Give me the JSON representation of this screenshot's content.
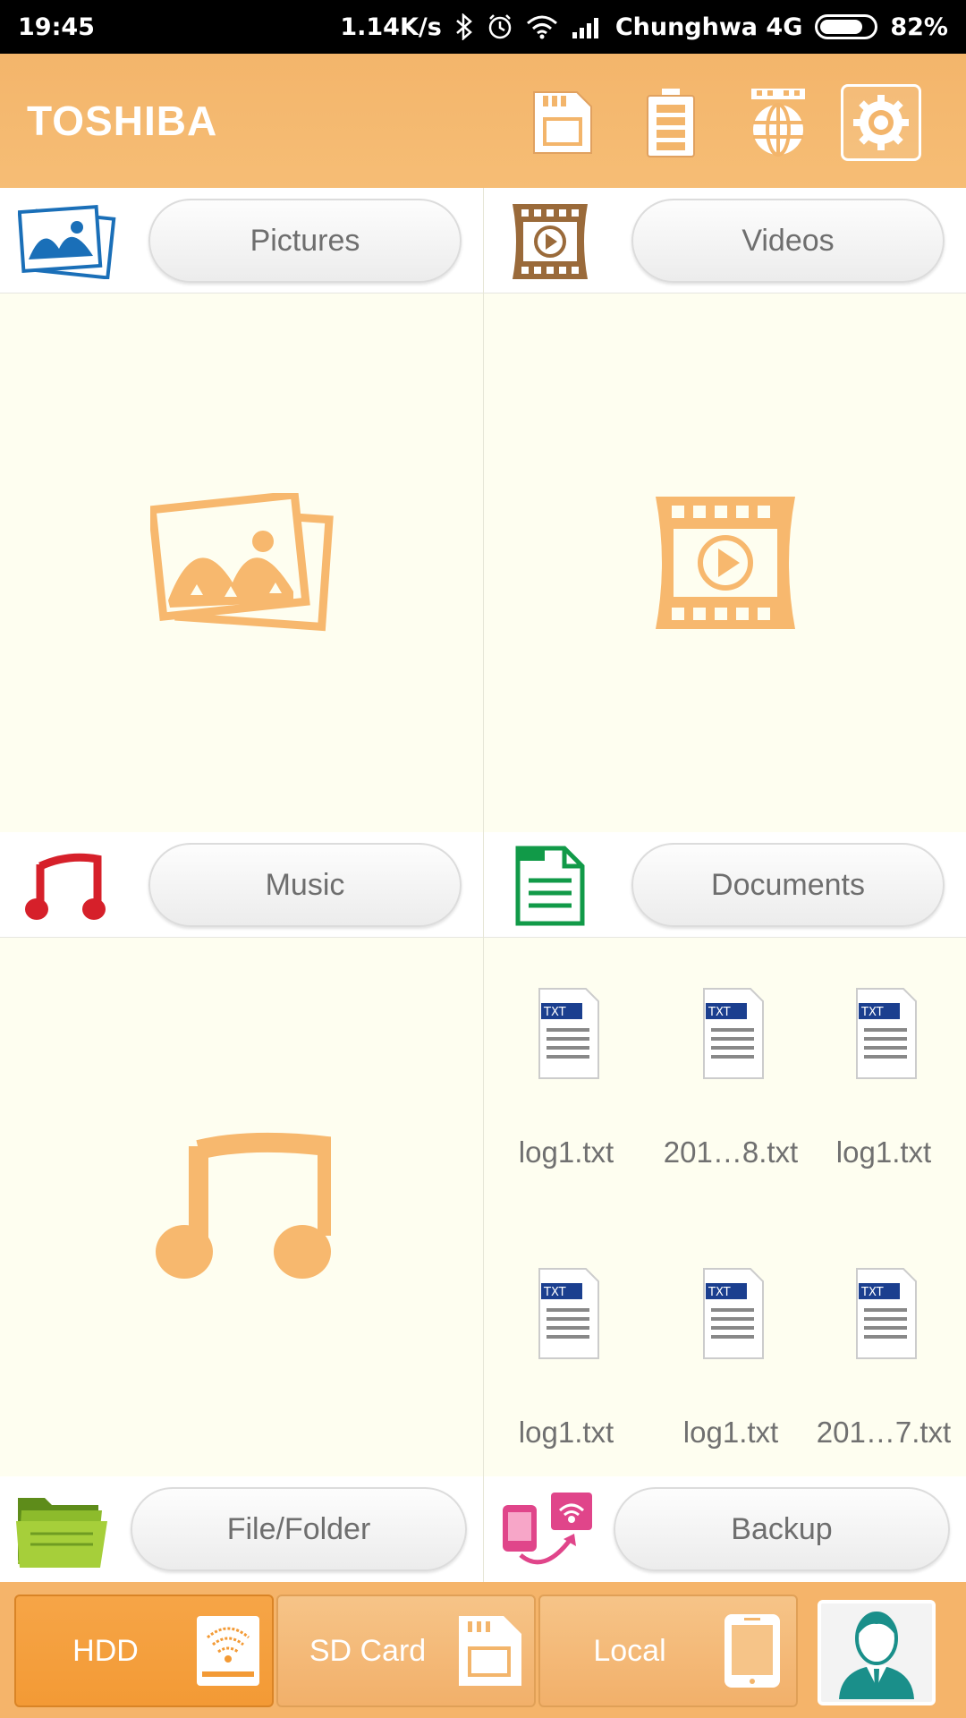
{
  "status_bar": {
    "time": "19:45",
    "net_speed": "1.14K/s",
    "carrier": "Chunghwa 4G",
    "battery": "82%",
    "battery_level": 0.82
  },
  "header": {
    "brand": "TOSHIBA",
    "buttons": [
      "sd-card-icon",
      "battery-icon",
      "network-globe-icon",
      "settings-gear-icon"
    ]
  },
  "categories": {
    "pictures": "Pictures",
    "videos": "Videos",
    "music": "Music",
    "documents": "Documents",
    "file_folder": "File/Folder",
    "backup": "Backup"
  },
  "documents": {
    "files": [
      {
        "name": "log1.txt",
        "type": "TXT"
      },
      {
        "name": "201…8.txt",
        "type": "TXT"
      },
      {
        "name": "log1.txt",
        "type": "TXT"
      },
      {
        "name": "log1.txt",
        "type": "TXT"
      },
      {
        "name": "log1.txt",
        "type": "TXT"
      },
      {
        "name": "201…7.txt",
        "type": "TXT"
      }
    ]
  },
  "bottom_tabs": {
    "hdd": "HDD",
    "sd_card": "SD Card",
    "local": "Local",
    "active": "HDD"
  },
  "colors": {
    "accent": "#f5b46a",
    "panel_bg": "#fefef0",
    "icon_orange": "#f7b86e"
  }
}
